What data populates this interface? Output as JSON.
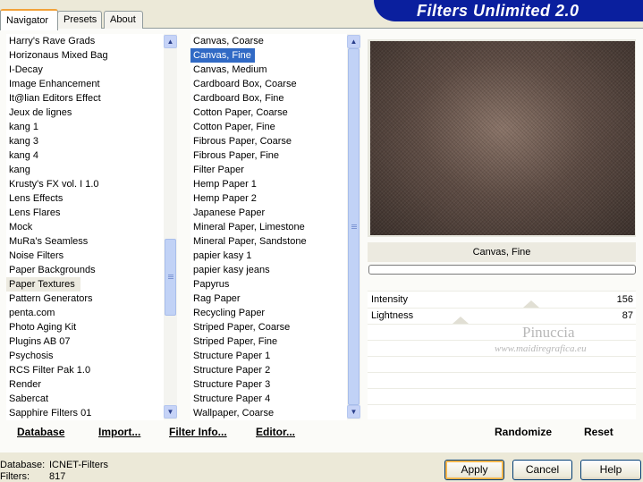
{
  "tabs": [
    {
      "label": "Navigator"
    },
    {
      "label": "Presets"
    },
    {
      "label": "About"
    }
  ],
  "banner": {
    "title": "Filters Unlimited 2.0"
  },
  "categories": {
    "items": [
      "Harry's Rave Grads",
      "Horizonaus Mixed Bag",
      "I-Decay",
      "Image Enhancement",
      "It@lian Editors Effect",
      "Jeux de lignes",
      "kang 1",
      "kang 3",
      "kang 4",
      "kang",
      "Krusty's FX vol. I 1.0",
      "Lens Effects",
      "Lens Flares",
      "Mock",
      "MuRa's Seamless",
      "Noise Filters",
      "Paper Backgrounds",
      "Paper Textures",
      "Pattern Generators",
      "penta.com",
      "Photo Aging Kit",
      "Plugins AB 07",
      "Psychosis",
      "RCS Filter Pak 1.0",
      "Render",
      "Sabercat",
      "Sapphire Filters 01"
    ],
    "selected": "Paper Textures"
  },
  "filters": {
    "items": [
      "Canvas, Coarse",
      "Canvas, Fine",
      "Canvas, Medium",
      "Cardboard Box, Coarse",
      "Cardboard Box, Fine",
      "Cotton Paper, Coarse",
      "Cotton Paper, Fine",
      "Fibrous Paper, Coarse",
      "Fibrous Paper, Fine",
      "Filter Paper",
      "Hemp Paper 1",
      "Hemp Paper 2",
      "Japanese Paper",
      "Mineral Paper, Limestone",
      "Mineral Paper, Sandstone",
      "papier kasy 1",
      "papier kasy jeans",
      "Papyrus",
      "Rag Paper",
      "Recycling Paper",
      "Striped Paper, Coarse",
      "Striped Paper, Fine",
      "Structure Paper 1",
      "Structure Paper 2",
      "Structure Paper 3",
      "Structure Paper 4",
      "Wallpaper, Coarse"
    ],
    "selected": "Canvas, Fine"
  },
  "preview": {
    "filter_name": "Canvas, Fine"
  },
  "sliders": [
    {
      "label": "Intensity",
      "value": "156"
    },
    {
      "label": "Lightness",
      "value": "87"
    }
  ],
  "watermark": {
    "name": "Pinuccia",
    "url": "www.maidiregrafica.eu"
  },
  "link_buttons": {
    "database": "Database",
    "import": "Import...",
    "filter_info": "Filter Info...",
    "editor": "Editor...",
    "randomize": "Randomize",
    "reset": "Reset"
  },
  "footer": {
    "database_label": "Database:",
    "database_value": "ICNET-Filters",
    "filters_label": "Filters:",
    "filters_value": "817"
  },
  "buttons": {
    "apply": "Apply",
    "cancel": "Cancel",
    "help": "Help"
  }
}
